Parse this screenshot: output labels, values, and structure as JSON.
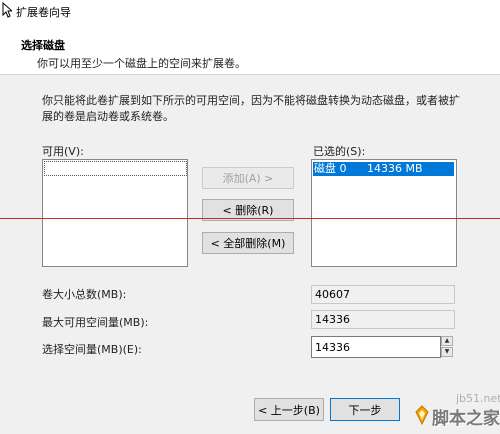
{
  "window": {
    "title": "扩展卷向导"
  },
  "header": {
    "title": "选择磁盘",
    "subtitle": "你可以用至少一个磁盘上的空间来扩展卷。"
  },
  "description": "你只能将此卷扩展到如下所示的可用空间，因为不能将磁盘转换为动态磁盘，或者被扩展的卷是启动卷或系统卷。",
  "available": {
    "label": "可用(V):",
    "items": []
  },
  "selected": {
    "label": "已选的(S):",
    "items": [
      {
        "name": "磁盘 0",
        "size": "14336 MB"
      }
    ]
  },
  "buttons": {
    "add": "添加(A) >",
    "remove": "< 删除(R)",
    "remove_all": "< 全部删除(M)",
    "back": "< 上一步(B)",
    "next": "下一步"
  },
  "fields": {
    "total_label": "卷大小总数(MB):",
    "total_value": "40607",
    "max_label": "最大可用空间量(MB):",
    "max_value": "14336",
    "select_label": "选择空间量(MB)(E):",
    "select_value": "14336"
  },
  "watermark": {
    "url": "jb51.net",
    "text": "脚本之家"
  }
}
